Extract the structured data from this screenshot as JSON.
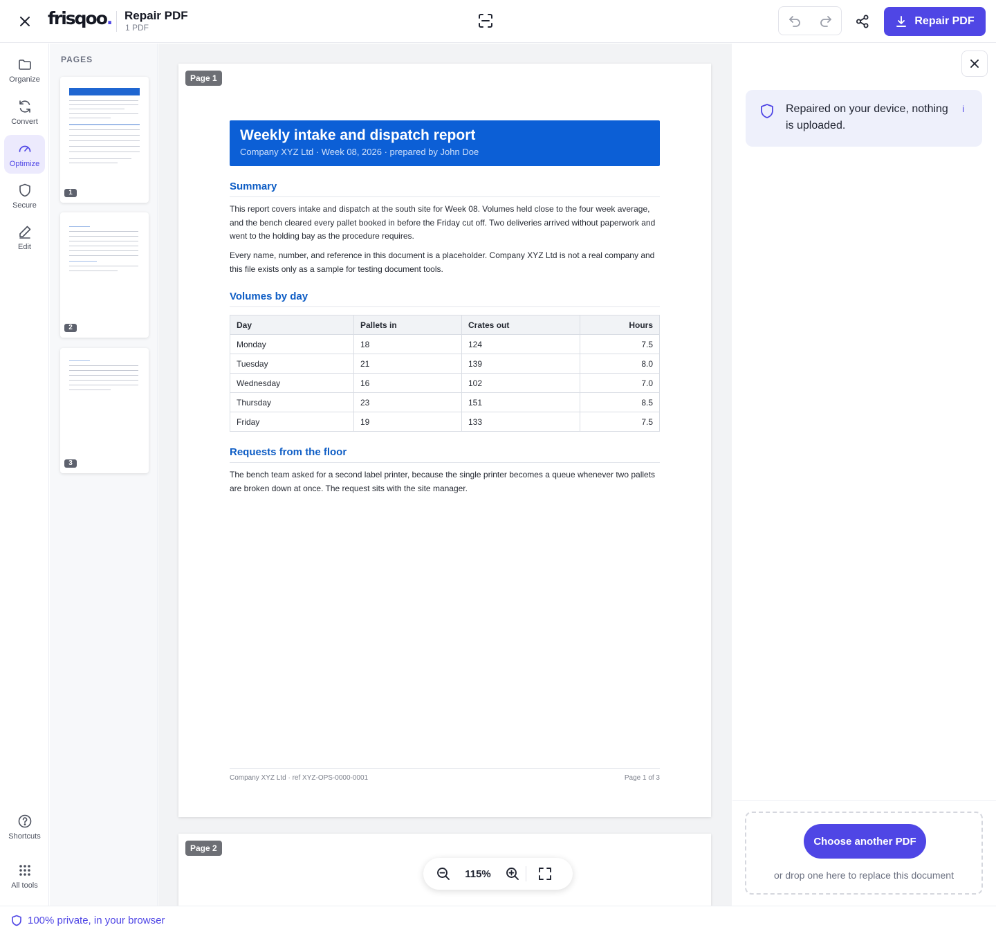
{
  "header": {
    "brand": "frisqoo",
    "brand_dot": ".",
    "title": "Repair PDF",
    "subtitle": "1 PDF",
    "primary_action": "Repair PDF"
  },
  "rail": {
    "items": [
      {
        "label": "Organize",
        "icon": "folder-icon"
      },
      {
        "label": "Convert",
        "icon": "refresh-icon"
      },
      {
        "label": "Optimize",
        "icon": "gauge-icon",
        "active": true
      },
      {
        "label": "Secure",
        "icon": "shield-icon"
      },
      {
        "label": "Edit",
        "icon": "pencil-icon"
      }
    ],
    "bottom": [
      {
        "label": "Shortcuts",
        "icon": "help-circle-icon"
      },
      {
        "label": "All tools",
        "icon": "grid-dots-icon"
      }
    ]
  },
  "pages_panel": {
    "title": "PAGES",
    "thumbnails": [
      "1",
      "2",
      "3"
    ]
  },
  "document": {
    "page1_tag": "Page 1",
    "page2_tag": "Page 2",
    "title": "Weekly intake and dispatch report",
    "subtitle": "Company XYZ Ltd · Week 08, 2026 · prepared by John Doe",
    "summary_heading": "Summary",
    "summary_p1": "This report covers intake and dispatch at the south site for Week 08. Volumes held close to the four week average, and the bench cleared every pallet booked in before the Friday cut off. Two deliveries arrived without paperwork and went to the holding bay as the procedure requires.",
    "summary_p2": "Every name, number, and reference in this document is a placeholder. Company XYZ Ltd is not a real company and this file exists only as a sample for testing document tools.",
    "volumes_heading": "Volumes by day",
    "table": {
      "headers": [
        "Day",
        "Pallets in",
        "Crates out",
        "Hours"
      ],
      "rows": [
        [
          "Monday",
          "18",
          "124",
          "7.5"
        ],
        [
          "Tuesday",
          "21",
          "139",
          "8.0"
        ],
        [
          "Wednesday",
          "16",
          "102",
          "7.0"
        ],
        [
          "Thursday",
          "23",
          "151",
          "8.5"
        ],
        [
          "Friday",
          "19",
          "133",
          "7.5"
        ]
      ]
    },
    "requests_heading": "Requests from the floor",
    "requests_p": "The bench team asked for a second label printer, because the single printer becomes a queue whenever two pallets are broken down at once. The request sits with the site manager.",
    "footer_left": "Company XYZ Ltd · ref XYZ-OPS-0000-0001",
    "footer_right": "Page 1 of 3"
  },
  "zoom": {
    "value": "115%"
  },
  "right_panel": {
    "notice": "Repaired on your device, nothing is uploaded.",
    "info_glyph": "i",
    "choose_button": "Choose another PDF",
    "drop_hint": "or drop one here to replace this document"
  },
  "status": {
    "text": "100% private, in your browser"
  },
  "colors": {
    "accent": "#4f46e5",
    "doc_blue": "#0c5fd6"
  }
}
